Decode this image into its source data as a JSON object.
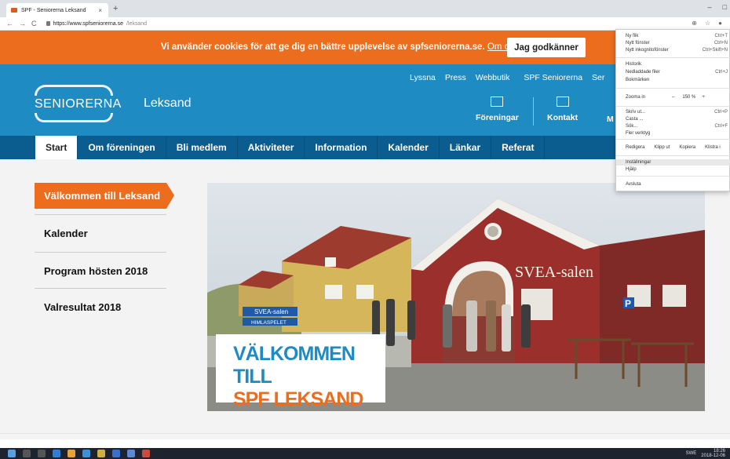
{
  "browser": {
    "tab_title": "SPF - Seniorerna Leksand",
    "tab_close": "×",
    "new_tab": "+",
    "window_controls": [
      "–",
      "□",
      "×"
    ],
    "nav": [
      "←",
      "→",
      "C"
    ],
    "url_host": "https://www.spfseniorerna.se",
    "url_path": "/leksand",
    "addr_icons": [
      "⊕",
      "☆",
      "●"
    ]
  },
  "cookie": {
    "message": "Vi använder cookies för att ge dig en bättre upplevelse av spfseniorerna.se.",
    "link": "Om cookies",
    "accept": "Jag godkänner"
  },
  "header": {
    "logo_text": "SENIORERNA",
    "subtitle": "Leksand",
    "top_links": [
      "Lyssna",
      "Press",
      "Webbutik",
      "SPF Seniorerna",
      "Ser"
    ],
    "icon_links": [
      "Föreningar",
      "Kontakt",
      "M"
    ]
  },
  "main_nav": {
    "items": [
      "Start",
      "Om föreningen",
      "Bli medlem",
      "Aktiviteter",
      "Information",
      "Kalender",
      "Länkar",
      "Referat"
    ]
  },
  "sidebar": {
    "active": "Välkommen till Leksand",
    "items": [
      "Kalender",
      "Program hösten 2018",
      "Valresultat 2018"
    ]
  },
  "hero": {
    "caption_line1": "VÄLKOMMEN TILL",
    "caption_line2": "SPF LEKSAND",
    "building_sign": "SVEA-salen",
    "street_sign1": "SVEA-salen",
    "street_sign2": "HIMLASPELET"
  },
  "chrome_menu": {
    "items": [
      {
        "label": "Ny flik",
        "shortcut": "Ctrl+T"
      },
      {
        "label": "Nytt fönster",
        "shortcut": "Ctrl+N"
      },
      {
        "label": "Nytt inkognitofönster",
        "shortcut": "Ctrl+Skift+N"
      },
      {
        "label": "Historik",
        "shortcut": ""
      },
      {
        "label": "Nedladdade filer",
        "shortcut": "Ctrl+J"
      },
      {
        "label": "Bokmärken",
        "shortcut": ""
      },
      {
        "label": "Skriv ut...",
        "shortcut": "Ctrl+P"
      },
      {
        "label": "Casta ...",
        "shortcut": ""
      },
      {
        "label": "Sök...",
        "shortcut": "Ctrl+F"
      },
      {
        "label": "Fler verktyg",
        "shortcut": ""
      },
      {
        "label": "Inställningar",
        "shortcut": ""
      },
      {
        "label": "Hjälp",
        "shortcut": ""
      },
      {
        "label": "Avsluta",
        "shortcut": ""
      }
    ],
    "zoom_label": "Zooma in",
    "zoom_minus": "–",
    "zoom_value": "150 %",
    "zoom_plus": "+",
    "edit_label": "Redigera",
    "cut": "Klipp ut",
    "copy": "Kopiera",
    "paste": "Klistra i"
  },
  "taskbar": {
    "lang": "SWE",
    "time": "18:26",
    "date": "2018-12-06"
  },
  "colors": {
    "orange": "#ec6d1e",
    "blue": "#1e8bc3",
    "navy": "#0c5d8f"
  }
}
